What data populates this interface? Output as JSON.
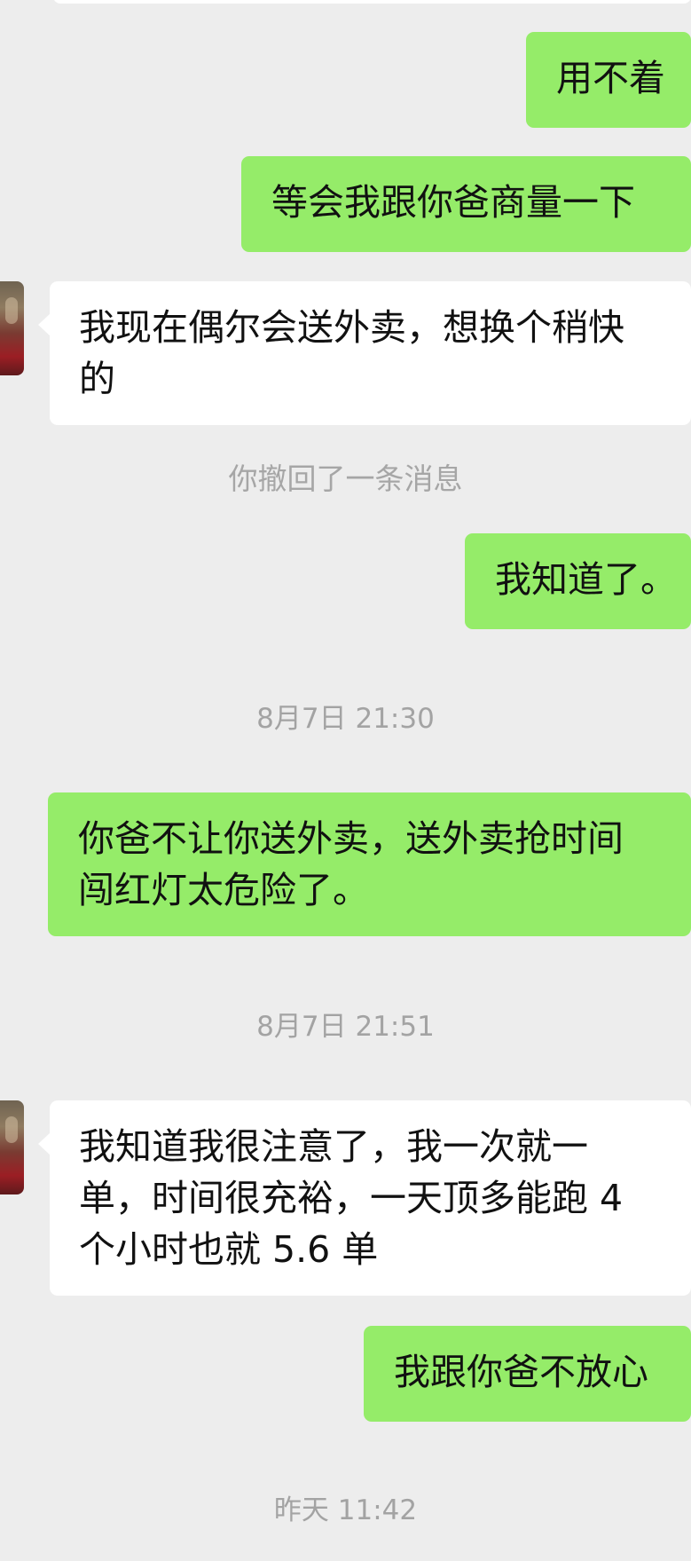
{
  "messages": [
    {
      "from": "me",
      "text": "用不着"
    },
    {
      "from": "me",
      "text": "等会我跟你爸商量一下"
    },
    {
      "from": "other",
      "lines": [
        "我现在偶尔会送外卖，想换个稍快",
        "的"
      ]
    },
    {
      "system": "你撤回了一条消息"
    },
    {
      "from": "me",
      "text": "我知道了。"
    },
    {
      "timestamp": "8月7日 21:30"
    },
    {
      "from": "me",
      "lines": [
        "你爸不让你送外卖，送外卖抢时间",
        "闯红灯太危险了。"
      ]
    },
    {
      "timestamp": "8月7日 21:51"
    },
    {
      "from": "other",
      "lines": [
        "我知道我很注意了，我一次就一",
        "单，时间很充裕，一天顶多能跑 4",
        "个小时也就 5.6 单"
      ]
    },
    {
      "from": "me",
      "text": "我跟你爸不放心"
    },
    {
      "timestamp": "昨天 11:42"
    }
  ],
  "colors": {
    "background": "#ededed",
    "outgoing_bubble": "#95ec69",
    "incoming_bubble": "#ffffff",
    "system_text": "#a6a6a6"
  }
}
